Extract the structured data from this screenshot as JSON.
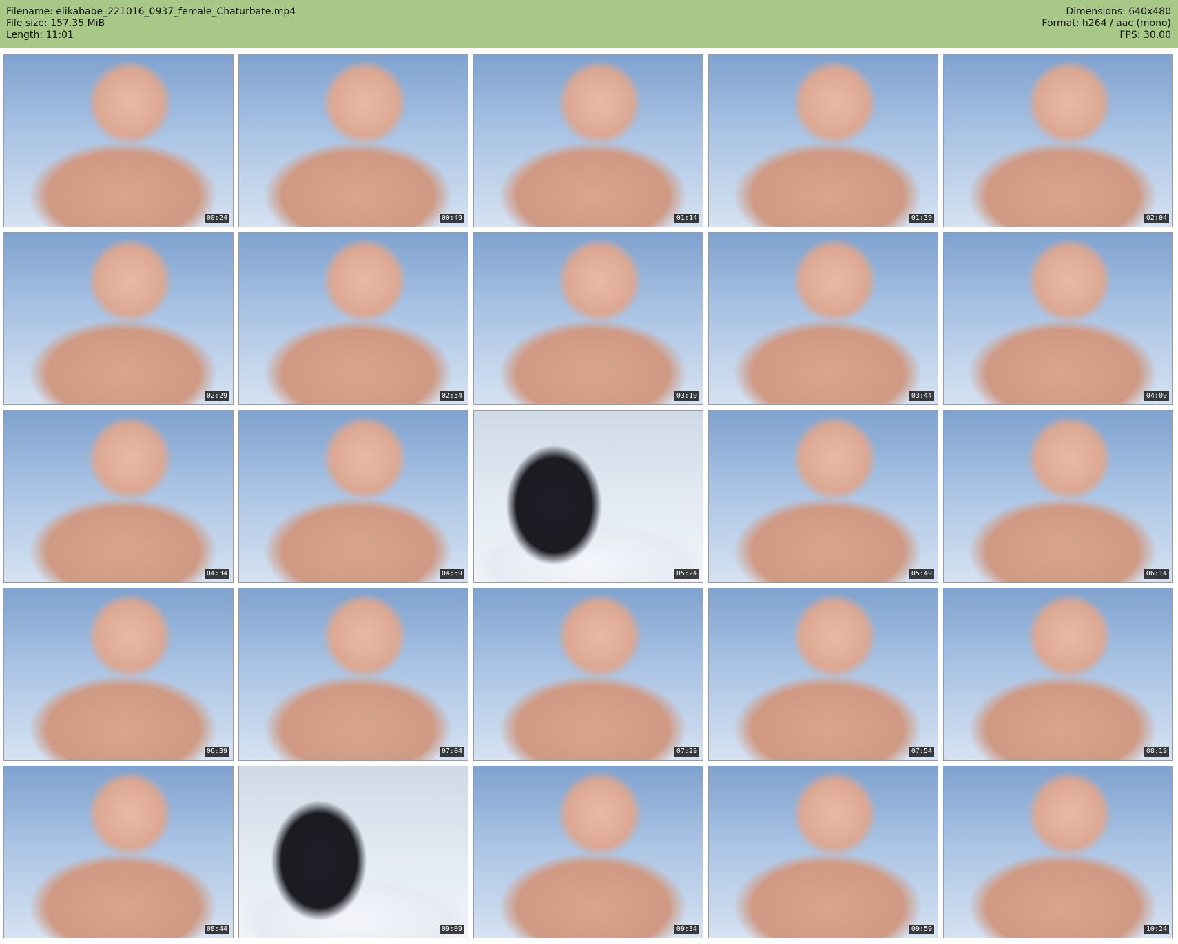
{
  "header": {
    "filename_line": "Filename: elikababe_221016_0937_female_Chaturbate.mp4",
    "filesize_line": "File size: 157.35 MiB",
    "length_line": "Length: 11:01",
    "dimensions_line": "Dimensions: 640x480",
    "format_line": "Format: h264 / aac (mono)",
    "fps_line": "FPS: 30.00"
  },
  "thumbnails": [
    {
      "time": "00:24"
    },
    {
      "time": "00:49"
    },
    {
      "time": "01:14"
    },
    {
      "time": "01:39"
    },
    {
      "time": "02:04"
    },
    {
      "time": "02:29"
    },
    {
      "time": "02:54"
    },
    {
      "time": "03:19"
    },
    {
      "time": "03:44"
    },
    {
      "time": "04:09"
    },
    {
      "time": "04:34"
    },
    {
      "time": "04:59"
    },
    {
      "time": "05:24"
    },
    {
      "time": "05:49"
    },
    {
      "time": "06:14"
    },
    {
      "time": "06:39"
    },
    {
      "time": "07:04"
    },
    {
      "time": "07:29"
    },
    {
      "time": "07:54"
    },
    {
      "time": "08:19"
    },
    {
      "time": "08:44"
    },
    {
      "time": "09:09"
    },
    {
      "time": "09:34"
    },
    {
      "time": "09:59"
    },
    {
      "time": "10:24"
    }
  ]
}
